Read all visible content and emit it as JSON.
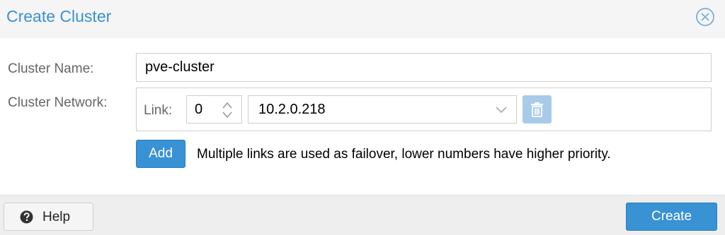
{
  "dialog": {
    "title": "Create Cluster",
    "close_icon": "close-circle-icon"
  },
  "form": {
    "cluster_name_label": "Cluster Name:",
    "cluster_name_value": "pve-cluster",
    "cluster_network_label": "Cluster Network:",
    "link_label": "Link:",
    "link_number": "0",
    "link_address": "10.2.0.218",
    "trash_icon": "trash-icon",
    "add_label": "Add",
    "hint": "Multiple links are used as failover, lower numbers have higher priority."
  },
  "footer": {
    "help_label": "Help",
    "help_icon": "question-circle-icon",
    "create_label": "Create"
  },
  "colors": {
    "accent": "#3892d4",
    "accent_disabled": "#a8cbea"
  }
}
